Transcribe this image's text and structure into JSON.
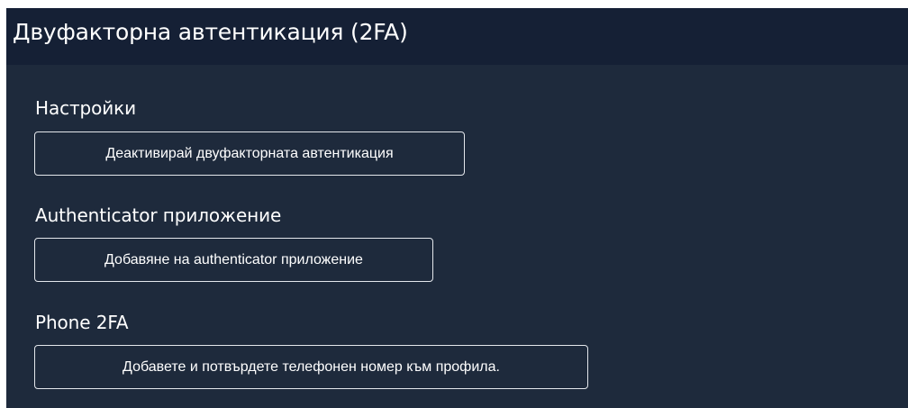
{
  "header": {
    "title": "Двуфакторна автентикация (2FA)"
  },
  "sections": [
    {
      "title": "Настройки",
      "button_label": "Деактивирай двуфакторната автентикация"
    },
    {
      "title": "Authenticator приложение",
      "button_label": "Добавяне на authenticator приложение"
    },
    {
      "title": "Phone 2FA",
      "button_label": "Добавете и потвърдете телефонен номер към профила."
    }
  ],
  "colors": {
    "header_bg": "#152035",
    "content_bg": "#1e2a3c",
    "text": "#ffffff",
    "button_border": "#e4e7ec"
  }
}
